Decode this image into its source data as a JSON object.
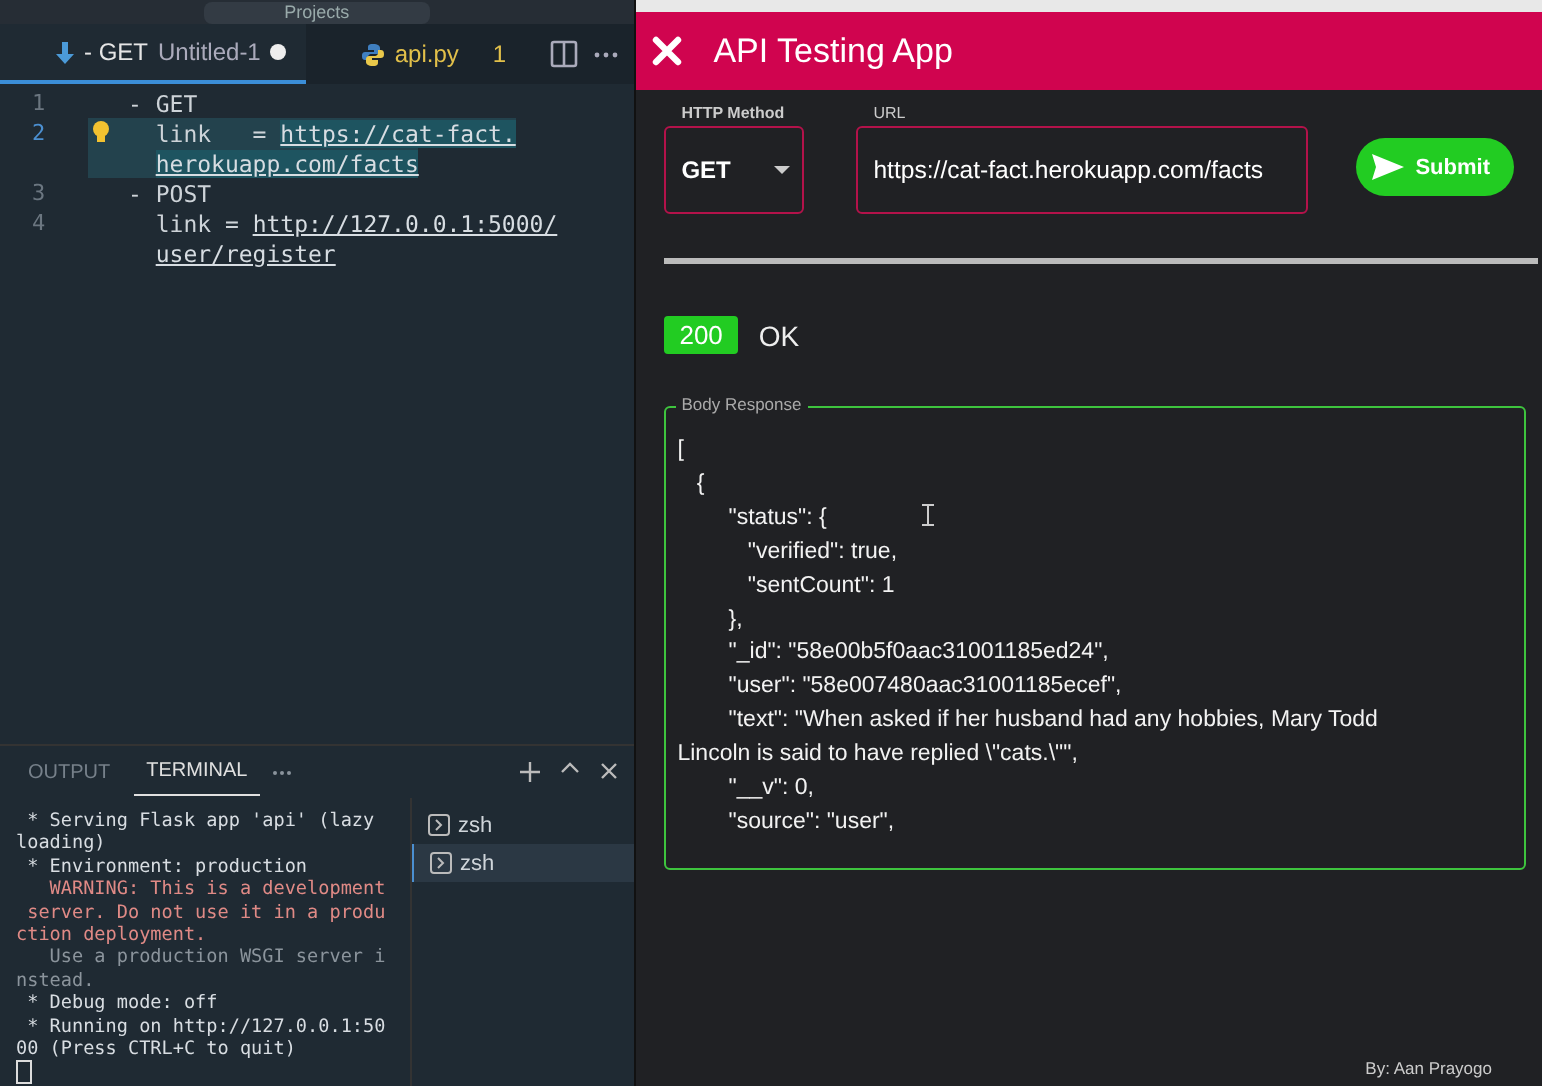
{
  "editor": {
    "title_search": "Projects",
    "tabs": [
      {
        "kind": "yaml",
        "name": "- GET",
        "detail": "Untitled-1",
        "modified": true,
        "selected": true
      },
      {
        "kind": "python",
        "name": "api.py",
        "badge": "1",
        "modified": false,
        "selected": false
      }
    ],
    "lines": [
      {
        "number": "1",
        "text": "- GET",
        "current": false,
        "hint": false
      },
      {
        "number": "2",
        "text": "  link   = ",
        "link": "https://cat-fact.",
        "current": true,
        "hint": true
      },
      {
        "link": "herokuapp.com/facts",
        "current": true,
        "hint": false
      },
      {
        "number": "3",
        "text": "- POST",
        "current": false,
        "hint": false
      },
      {
        "number": "4",
        "text": "  link = ",
        "link": "http://127.0.0.1:5000/",
        "current": false,
        "hint": false
      },
      {
        "link": "user/register",
        "current": false,
        "hint": false
      }
    ]
  },
  "panel": {
    "tabs": [
      {
        "label": "OUTPUT",
        "selected": false
      },
      {
        "label": "TERMINAL",
        "selected": true
      }
    ],
    "terminal_lines": [
      {
        "kind": "normal",
        "text": " * Serving Flask app 'api' (lazy\nloading)"
      },
      {
        "kind": "normal",
        "text": " * Environment: production"
      },
      {
        "kind": "warning",
        "text": "   WARNING: This is a development\n server. Do not use it in a produ\nction deployment."
      },
      {
        "kind": "dim",
        "text": "   Use a production WSGI server i\nnstead."
      },
      {
        "kind": "normal",
        "text": " * Debug mode: off"
      },
      {
        "kind": "normal",
        "text": " * Running on http://127.0.0.1:50\n00 (Press CTRL+C to quit)"
      }
    ],
    "shells": [
      {
        "label": "zsh",
        "selected": false
      },
      {
        "label": "zsh",
        "selected": true
      }
    ]
  },
  "app": {
    "title": "API Testing App",
    "method": {
      "label": "HTTP Method",
      "value": "GET"
    },
    "url": {
      "label": "URL",
      "value": "https://cat-fact.herokuapp.com/facts"
    },
    "submit": "Submit",
    "status": {
      "code": "200",
      "text": "OK"
    },
    "body": {
      "label": "Body Response",
      "lines": [
        "[",
        "   {",
        "        \"status\": {",
        "           \"verified\": true,",
        "           \"sentCount\": 1",
        "        },",
        "        \"_id\": \"58e00b5f0aac31001185ed24\",",
        "        \"user\": \"58e007480aac31001185ecef\",",
        "        \"text\": \"When asked if her husband had any hobbies, Mary Todd\nLincoln is said to have replied \\\"cats.\\\"\",",
        "        \"__v\": 0,",
        "        \"source\": \"user\","
      ]
    },
    "footer": "By: Aan Prayogo"
  }
}
